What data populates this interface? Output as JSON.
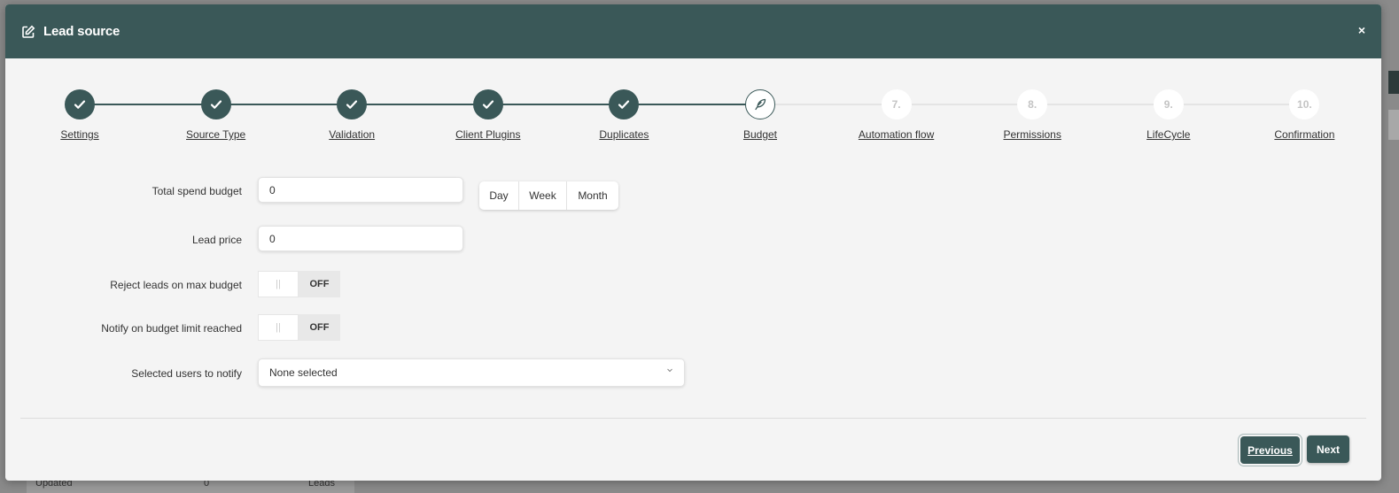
{
  "modal": {
    "title": "Lead source",
    "close_label": "×"
  },
  "steps": [
    {
      "label": "Settings",
      "status": "done",
      "number": ""
    },
    {
      "label": "Source Type",
      "status": "done",
      "number": ""
    },
    {
      "label": "Validation",
      "status": "done",
      "number": ""
    },
    {
      "label": "Client Plugins",
      "status": "done",
      "number": ""
    },
    {
      "label": "Duplicates",
      "status": "done",
      "number": ""
    },
    {
      "label": "Budget",
      "status": "current",
      "number": ""
    },
    {
      "label": "Automation flow",
      "status": "todo",
      "number": "7."
    },
    {
      "label": "Permissions",
      "status": "todo",
      "number": "8."
    },
    {
      "label": "LifeCycle",
      "status": "todo",
      "number": "9."
    },
    {
      "label": "Confirmation",
      "status": "todo",
      "number": "10."
    }
  ],
  "form": {
    "total_spend_budget": {
      "label": "Total spend budget",
      "value": "0"
    },
    "period_options": [
      "Day",
      "Week",
      "Month"
    ],
    "lead_price": {
      "label": "Lead price",
      "value": "0"
    },
    "reject_leads": {
      "label": "Reject leads on max budget",
      "state": "OFF",
      "knob": "||"
    },
    "notify_budget": {
      "label": "Notify on budget limit reached",
      "state": "OFF",
      "knob": "||"
    },
    "users_to_notify": {
      "label": "Selected users to notify",
      "value": "None selected"
    }
  },
  "footer": {
    "previous_label": "Previous",
    "next_label": "Next"
  },
  "background": {
    "row_label": "Updated",
    "row_value": "0",
    "row_action": "Leads"
  },
  "colors": {
    "primary": "#3a5858",
    "modal_bg": "#f4f4f4"
  },
  "icons": {
    "header": "edit-icon",
    "done": "check-icon",
    "current": "feather-pen-icon",
    "select_caret": "chevron-down-icon"
  }
}
